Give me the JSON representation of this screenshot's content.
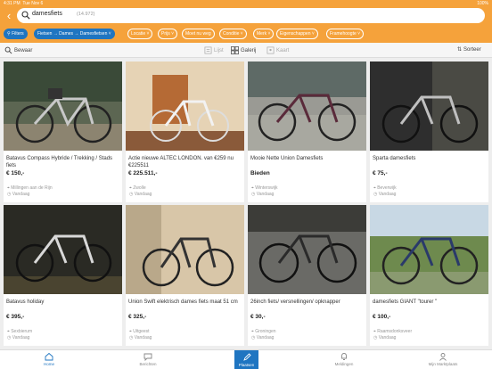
{
  "status": {
    "time": "4:31 PM",
    "date": "Tue Nov 6",
    "battery": "100%"
  },
  "search": {
    "query": "damesfiets",
    "count": "(14.972)"
  },
  "chips": [
    {
      "label": "Filters",
      "active": true
    },
    {
      "label": "Fietsen → Dames → Damesfietsen",
      "active": true
    },
    {
      "label": "Locatie",
      "active": false
    },
    {
      "label": "Prijs",
      "active": false
    },
    {
      "label": "Moet nu weg",
      "active": false
    },
    {
      "label": "Conditie",
      "active": false
    },
    {
      "label": "Merk",
      "active": false
    },
    {
      "label": "Eigenschappen",
      "active": false
    },
    {
      "label": "Framehoogte",
      "active": false
    }
  ],
  "toolbar": {
    "save": "Bewaar",
    "list": "Lijst",
    "gallery": "Galerij",
    "map": "Kaart",
    "sort": "Sorteer"
  },
  "listings": [
    {
      "title": "Batavus Compass Hybride / Trekking / Stads fiets",
      "price": "€ 150,-",
      "location": "Millingen aan de Rijn",
      "date": "Vandaag"
    },
    {
      "title": "Actie nieuwe ALTEC LONDON. van €259 nu €225511",
      "price": "€ 225.511,-",
      "location": "Zwolle",
      "date": "Vandaag"
    },
    {
      "title": "Mooie Nette Union Damesfiets",
      "price": "Bieden",
      "location": "Winterswijk",
      "date": "Vandaag"
    },
    {
      "title": "Sparta damesfiets",
      "price": "€ 75,-",
      "location": "Beverwijk",
      "date": "Vandaag"
    },
    {
      "title": "Batavus holiday",
      "price": "€ 395,-",
      "location": "Sexbierum",
      "date": "Vandaag"
    },
    {
      "title": "Union Swift elektrisch dames fiets maat 51 cm",
      "price": "€ 325,-",
      "location": "Uitgeest",
      "date": "Vandaag"
    },
    {
      "title": "26inch fiets/ versnellingen/ opknapper",
      "price": "€ 30,-",
      "location": "Groningen",
      "date": "Vandaag"
    },
    {
      "title": "damesfiets GIANT \"tourer \"",
      "price": "€ 100,-",
      "location": "Raamsdonksveer",
      "date": "Vandaag"
    }
  ],
  "tabs": {
    "home": "Home",
    "messages": "Berichten",
    "post": "Plaatsen",
    "notifications": "Meldingen",
    "account": "Mijn Marktplaats"
  },
  "colors": {
    "header": "#f5a23b",
    "accent": "#1f75c1",
    "background": "#eeeeee"
  }
}
